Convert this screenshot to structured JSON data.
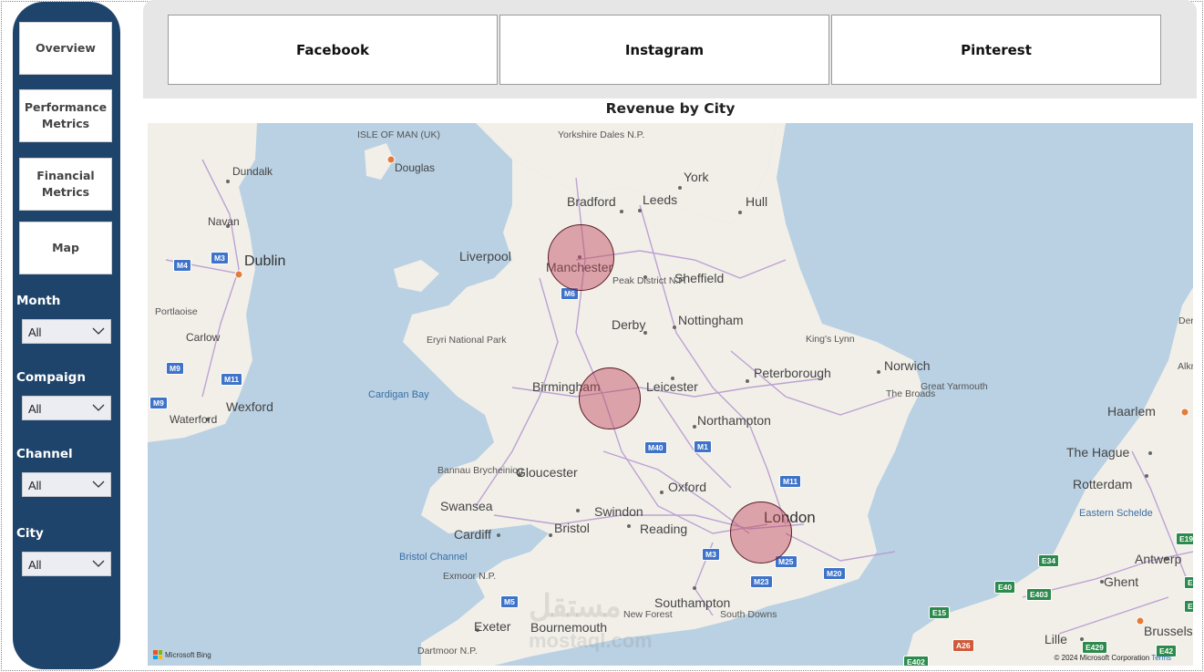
{
  "nav": {
    "overview": "Overview",
    "performance": "Performance\nMetrics",
    "financial": "Financial\nMetrics",
    "map": "Map"
  },
  "slicers": {
    "month": {
      "label": "Month",
      "value": "All"
    },
    "campaign": {
      "label": "Compaign",
      "value": "All"
    },
    "channel": {
      "label": "Channel",
      "value": "All"
    },
    "city": {
      "label": "City",
      "value": "All"
    }
  },
  "tabs": {
    "facebook": "Facebook",
    "instagram": "Instagram",
    "pinterest": "Pinterest"
  },
  "map": {
    "title": "Revenue by City",
    "places": {
      "isle_of_man": "ISLE OF MAN\n(UK)",
      "douglas": "Douglas",
      "yorkshire_dales": "Yorkshire\nDales N.P.",
      "york": "York",
      "bradford": "Bradford",
      "leeds": "Leeds",
      "hull": "Hull",
      "dundalk": "Dundalk",
      "navan": "Navan",
      "dublin": "Dublin",
      "liverpool": "Liverpool",
      "manchester": "Manchester",
      "sheffield": "Sheffield",
      "peak_district": "Peak\nDistrict\nN.P.",
      "portlaoise": "Portlaoise",
      "carlow": "Carlow",
      "eryri": "Eryri\nNational\nPark",
      "derby": "Derby",
      "nottingham": "Nottingham",
      "kings_lynn": "King's\nLynn",
      "norwich": "Norwich",
      "great_yarmouth": "Great\nYarmouth",
      "the_broads": "The\nBroads",
      "peterborough": "Peterborough",
      "cardigan_bay": "Cardigan\nBay",
      "birmingham": "Birmingham",
      "leicester": "Leicester",
      "wexford": "Wexford",
      "waterford": "Waterford",
      "northampton": "Northampton",
      "haarlem": "Haarlem",
      "bannau": "Bannau\nBrycheiniog",
      "gloucester": "Gloucester",
      "oxford": "Oxford",
      "the_hague": "The Hague",
      "rotterdam": "Rotterdam",
      "swansea": "Swansea",
      "swindon": "Swindon",
      "cardiff": "Cardiff",
      "bristol": "Bristol",
      "reading": "Reading",
      "london": "London",
      "eastern_schelde": "Eastern\nSchelde",
      "bristol_channel": "Bristol Channel",
      "antwerp": "Antwerp",
      "exmoor": "Exmoor\nN.P.",
      "southampton": "Southampton",
      "ghent": "Ghent",
      "new_forest": "New\nForest",
      "south_downs": "South\nDowns",
      "exeter": "Exeter",
      "bournemouth": "Bournemouth",
      "lille": "Lille",
      "brussels": "Brussels",
      "dartmoor": "Dartmoor\nN.P.",
      "den": "Der",
      "alk": "Alkr"
    },
    "roads": [
      "M6",
      "M4",
      "M3",
      "M9",
      "M11",
      "M9",
      "M40",
      "M1",
      "M11",
      "M5",
      "M3",
      "M25",
      "M23",
      "M20",
      "E19",
      "E34",
      "E40",
      "E403",
      "E15",
      "E17",
      "E314",
      "A26",
      "E42",
      "E429",
      "E402"
    ],
    "bubble_cities": [
      "Manchester",
      "Birmingham",
      "London"
    ],
    "attribution": "© 2024 Microsoft Corporation",
    "terms": "Terms",
    "bing": "Microsoft Bing",
    "watermark": "مستقل",
    "watermark_url": "mostaql.com"
  },
  "colors": {
    "sidebar": "#1f446b",
    "bubble": "#be465a",
    "sea": "#b9d1e3",
    "land": "#f2efe9"
  }
}
